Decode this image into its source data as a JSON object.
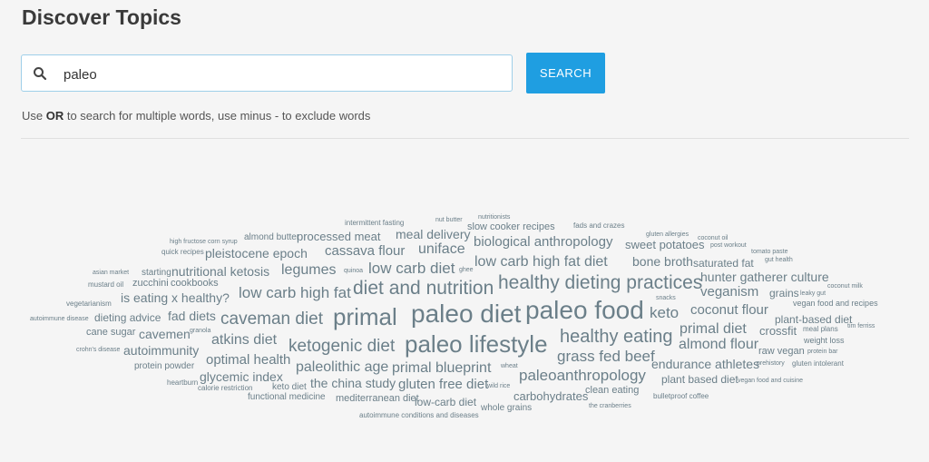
{
  "page": {
    "title": "Discover Topics"
  },
  "search": {
    "value": "paleo",
    "button_label": "SEARCH",
    "hint_prefix": "Use ",
    "hint_bold": "OR",
    "hint_suffix": " to search for multiple words, use minus - to exclude words"
  },
  "colors": {
    "accent": "#1f9ee1",
    "word": "#6b7f89",
    "background": "#f5f5f5"
  },
  "icons": [
    "search-icon"
  ],
  "word_cloud": [
    {
      "text": "intermittent fasting"
    },
    {
      "text": "nut butter"
    },
    {
      "text": "nutritionists"
    },
    {
      "text": "slow cooker recipes"
    },
    {
      "text": "fads and crazes"
    },
    {
      "text": "gluten allergies"
    },
    {
      "text": "coconut oil"
    },
    {
      "text": "almond butter"
    },
    {
      "text": "processed meat"
    },
    {
      "text": "meal delivery"
    },
    {
      "text": "post workout"
    },
    {
      "text": "high fructose corn syrup"
    },
    {
      "text": "biological anthropology"
    },
    {
      "text": "sweet potatoes"
    },
    {
      "text": "quick recipes"
    },
    {
      "text": "pleistocene epoch"
    },
    {
      "text": "cassava flour"
    },
    {
      "text": "uniface"
    },
    {
      "text": "tomato paste"
    },
    {
      "text": "gut health"
    },
    {
      "text": "bone broth"
    },
    {
      "text": "saturated fat"
    },
    {
      "text": "low carb high fat diet"
    },
    {
      "text": "asian market"
    },
    {
      "text": "starting"
    },
    {
      "text": "nutritional ketosis"
    },
    {
      "text": "legumes"
    },
    {
      "text": "quinoa"
    },
    {
      "text": "low carb diet"
    },
    {
      "text": "ghee"
    },
    {
      "text": "hunter gatherer culture"
    },
    {
      "text": "mustard oil"
    },
    {
      "text": "zucchini"
    },
    {
      "text": "cookbooks"
    },
    {
      "text": "healthy dieting practices"
    },
    {
      "text": "coconut milk"
    },
    {
      "text": "low carb high fat"
    },
    {
      "text": "diet and nutrition"
    },
    {
      "text": "veganism"
    },
    {
      "text": "grains"
    },
    {
      "text": "leaky gut"
    },
    {
      "text": "is eating x healthy?"
    },
    {
      "text": "snacks"
    },
    {
      "text": "vegetarianism"
    },
    {
      "text": "vegan food and recipes"
    },
    {
      "text": "paleo food"
    },
    {
      "text": "coconut flour"
    },
    {
      "text": "keto"
    },
    {
      "text": "dieting advice"
    },
    {
      "text": "fad diets"
    },
    {
      "text": "primal"
    },
    {
      "text": "paleo diet"
    },
    {
      "text": "plant-based diet"
    },
    {
      "text": "autoimmune disease"
    },
    {
      "text": "caveman diet"
    },
    {
      "text": "tim ferriss"
    },
    {
      "text": "primal diet"
    },
    {
      "text": "crossfit"
    },
    {
      "text": "granola"
    },
    {
      "text": "meal plans"
    },
    {
      "text": "cane sugar"
    },
    {
      "text": "cavemen"
    },
    {
      "text": "healthy eating"
    },
    {
      "text": "weight loss"
    },
    {
      "text": "atkins diet"
    },
    {
      "text": "paleo lifestyle"
    },
    {
      "text": "crohn's disease"
    },
    {
      "text": "autoimmunity"
    },
    {
      "text": "ketogenic diet"
    },
    {
      "text": "almond flour"
    },
    {
      "text": "raw vegan"
    },
    {
      "text": "protein bar"
    },
    {
      "text": "optimal health"
    },
    {
      "text": "grass fed beef"
    },
    {
      "text": "protein powder"
    },
    {
      "text": "paleolithic age"
    },
    {
      "text": "primal blueprint"
    },
    {
      "text": "wheat"
    },
    {
      "text": "endurance athletes"
    },
    {
      "text": "prehistory"
    },
    {
      "text": "gluten intolerant"
    },
    {
      "text": "glycemic index"
    },
    {
      "text": "paleoanthropology"
    },
    {
      "text": "heartburn"
    },
    {
      "text": "calorie restriction"
    },
    {
      "text": "keto diet"
    },
    {
      "text": "the china study"
    },
    {
      "text": "gluten free diet"
    },
    {
      "text": "wild rice"
    },
    {
      "text": "plant based diet"
    },
    {
      "text": "vegan food and cuisine"
    },
    {
      "text": "clean eating"
    },
    {
      "text": "functional medicine"
    },
    {
      "text": "mediterranean diet"
    },
    {
      "text": "low-carb diet"
    },
    {
      "text": "carbohydrates"
    },
    {
      "text": "bulletproof coffee"
    },
    {
      "text": "the cranberries"
    },
    {
      "text": "autoimmune conditions and diseases"
    },
    {
      "text": "whole grains"
    }
  ]
}
